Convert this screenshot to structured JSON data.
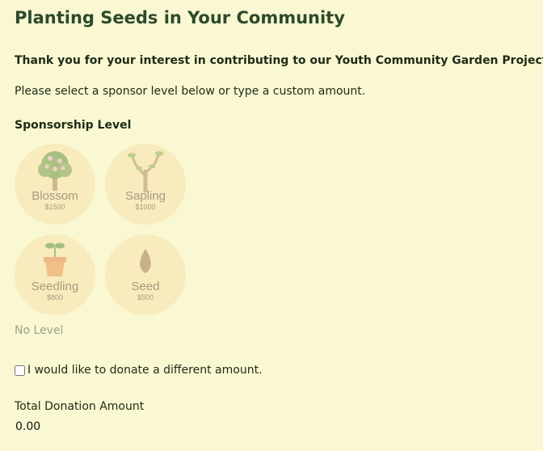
{
  "header": {
    "title": "Planting Seeds in Your Community"
  },
  "intro": {
    "thanks": "Thank you for your interest in contributing to our Youth Community Garden Project!",
    "instructions": "Please select a sponsor level below or type a custom amount."
  },
  "sponsorship": {
    "heading": "Sponsorship Level",
    "levels": [
      {
        "name": "Blossom",
        "amount": "$1500",
        "icon": "blossom-tree-icon"
      },
      {
        "name": "Sapling",
        "amount": "$1000",
        "icon": "sapling-icon"
      },
      {
        "name": "Seedling",
        "amount": "$800",
        "icon": "seedling-pot-icon"
      },
      {
        "name": "Seed",
        "amount": "$500",
        "icon": "seed-icon"
      }
    ],
    "no_level": "No Level"
  },
  "custom_amount": {
    "label": "I would like to donate a different amount.",
    "checked": false
  },
  "total": {
    "label": "Total Donation Amount",
    "value": "0.00"
  },
  "colors": {
    "background": "#f9f8d2",
    "title": "#2d4a2c",
    "level_circle": "#f8ebbd",
    "level_text": "#a49d80"
  }
}
